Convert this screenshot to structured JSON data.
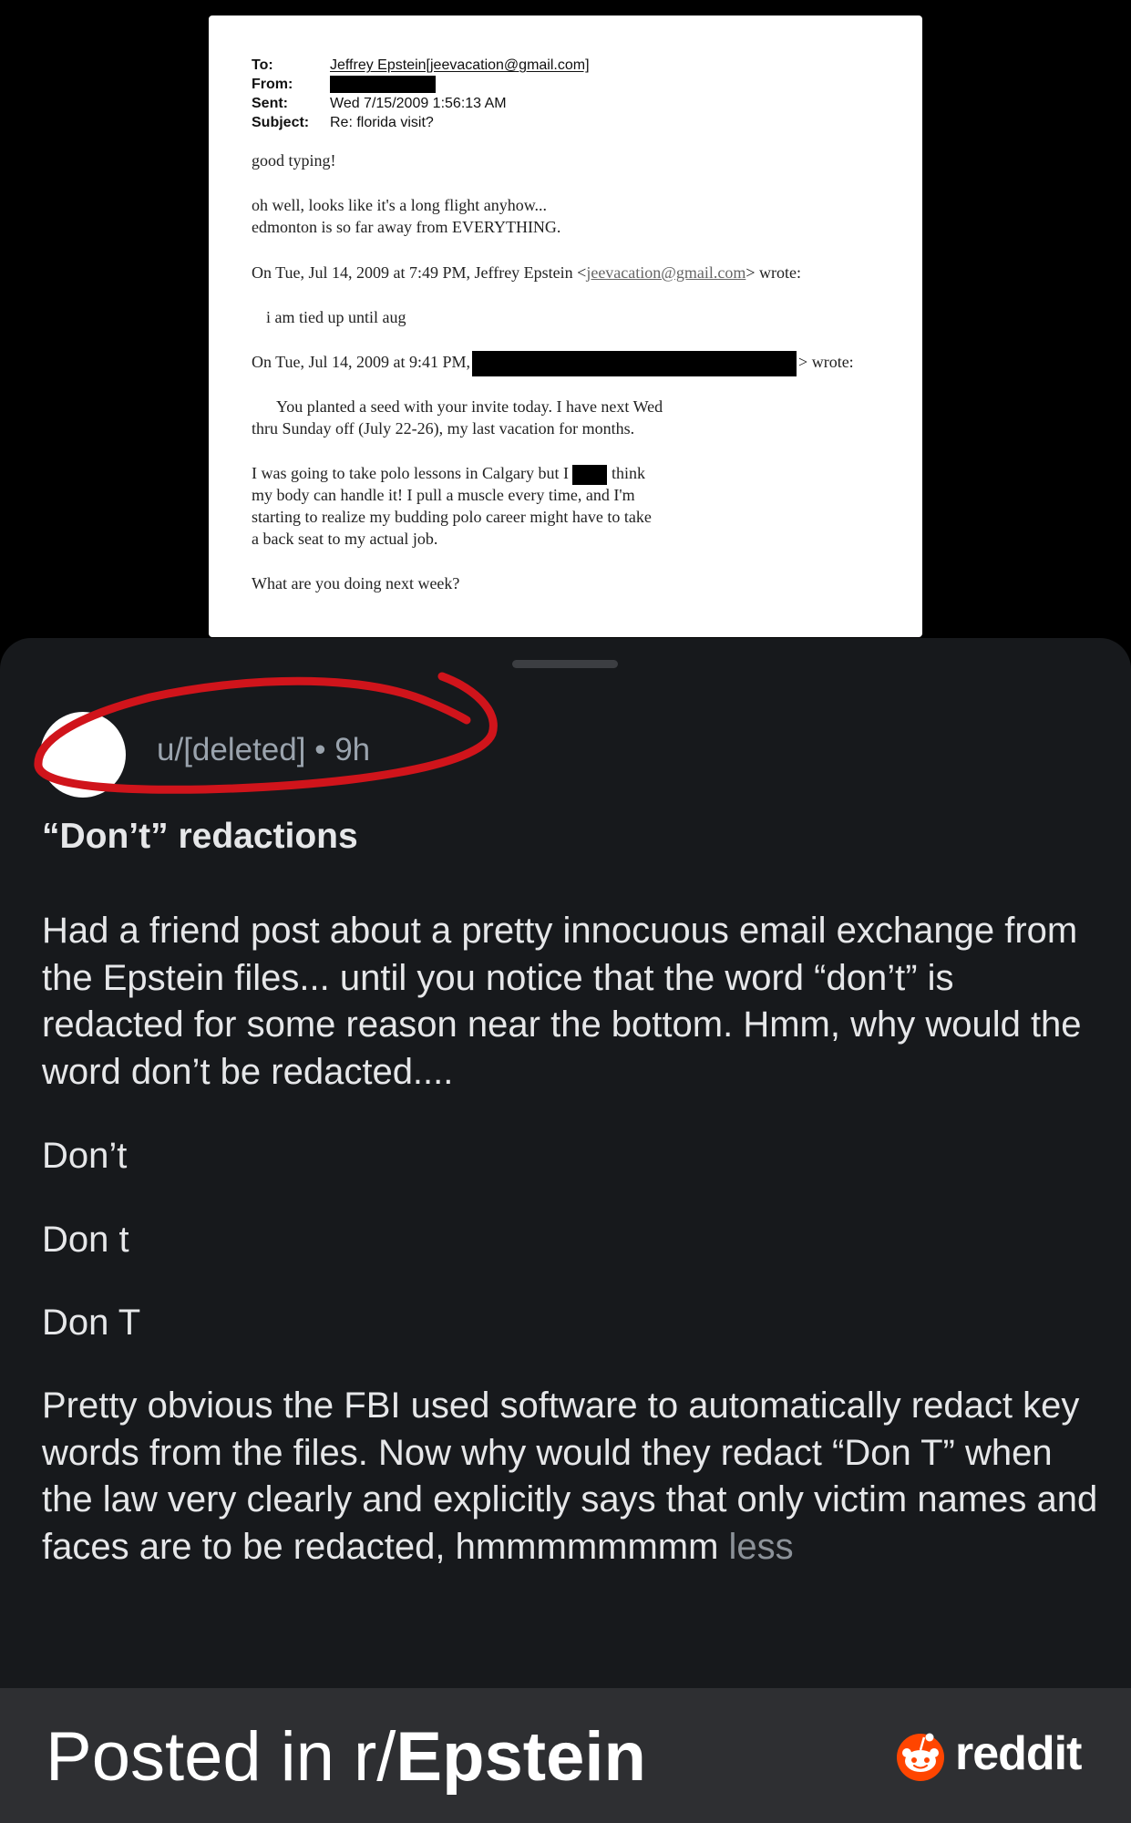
{
  "email": {
    "to_label": "To:",
    "to_value": "Jeffrey Epstein[jeevacation@gmail.com]",
    "from_label": "From:",
    "sent_label": "Sent:",
    "sent_value": "Wed 7/15/2009 1:56:13 AM",
    "subject_label": "Subject:",
    "subject_value": "Re: florida visit?",
    "line1": "good typing!",
    "line2": "oh well, looks like it's a long flight anyhow...",
    "line3": "edmonton is so far away from EVERYTHING.",
    "quote1_pre": "On Tue, Jul 14, 2009 at 7:49 PM, Jeffrey Epstein <",
    "quote1_link": "jeevacation@gmail.com",
    "quote1_post": "> wrote:",
    "line4": "i am tied up until aug",
    "quote2_pre": "On Tue, Jul 14, 2009 at 9:41 PM,",
    "quote2_post": "> wrote:",
    "para1_l1": "You planted a seed with your invite today. I have next Wed",
    "para1_l2": "thru Sunday off (July 22-26), my last vacation for months.",
    "para2_l1_pre": "I was going to take polo lessons in Calgary but I",
    "para2_l1_post": "think",
    "para2_l2": "my body can handle it! I pull a muscle every time, and I'm",
    "para2_l3": "starting to realize my budding polo career might have to take",
    "para2_l4": "a back seat to my actual job.",
    "line5": "What are you doing next week?"
  },
  "post": {
    "author": "u/[deleted]",
    "separator": "•",
    "age": "9h",
    "title": "“Don’t” redactions",
    "paragraphs": [
      "Had a friend post about a pretty innocuous email exchange from the Epstein files... until you notice that the word “don’t” is redacted for some reason near the bottom. Hmm, why would the word don’t be redacted....",
      "Don’t",
      "Don t",
      "Don T",
      "Pretty obvious the FBI used software to automatically redact key words from the files. Now why would they redact “Don T” when the law very clearly and explicitly says that only victim names and faces are to be redacted, hmmmmmmmm"
    ],
    "less_label": "less"
  },
  "footer": {
    "posted_prefix": "Posted in r/",
    "subreddit": "Epstein",
    "brand": "reddit"
  },
  "colors": {
    "card_bg": "#17191c",
    "footer_bg": "#2e2f32",
    "annotation_red": "#d0141b",
    "reddit_orange": "#ff4500"
  }
}
